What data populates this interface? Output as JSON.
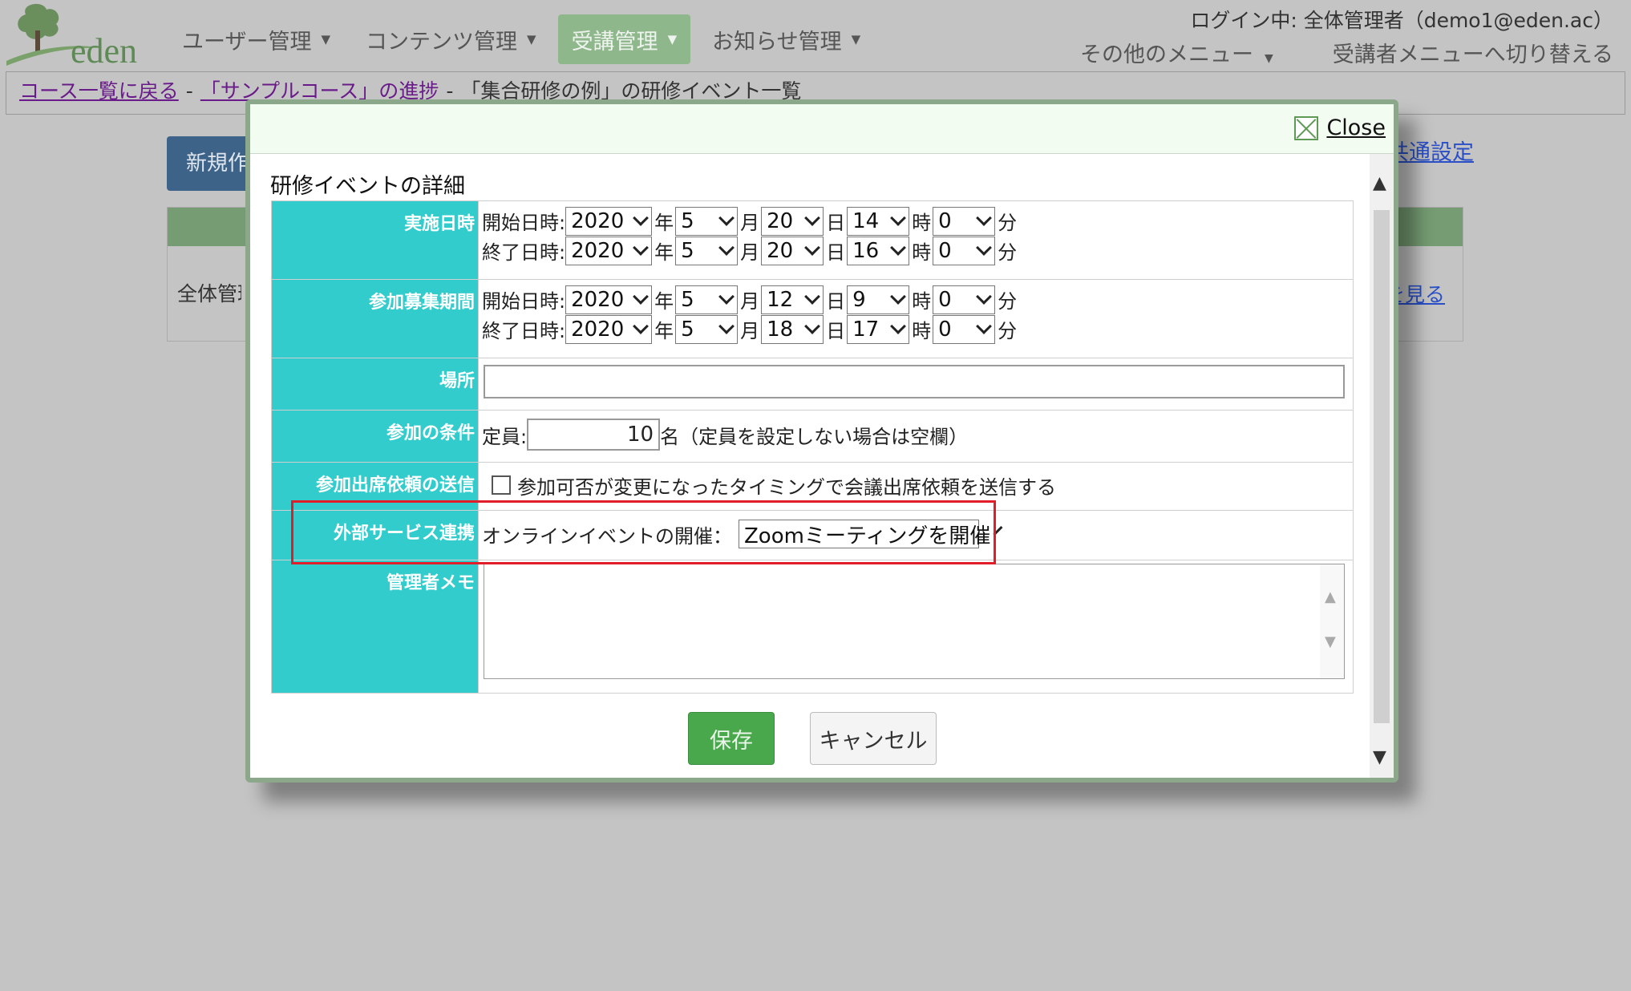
{
  "brand": {
    "name": "eden"
  },
  "nav": [
    {
      "label": "ユーザー管理",
      "active": false
    },
    {
      "label": "コンテンツ管理",
      "active": false
    },
    {
      "label": "受講管理",
      "active": true
    },
    {
      "label": "お知らせ管理",
      "active": false
    }
  ],
  "user": {
    "login_text": "ログイン中: 全体管理者（demo1@eden.ac）"
  },
  "top_menu": {
    "other_label": "その他のメニュー",
    "switch_label": "受講者メニューへ切り替える"
  },
  "breadcrumb": {
    "course_list": "コース一覧に戻る",
    "progress": "「サンプルコース」の進捗",
    "current": "「集合研修の例」の研修イベント一覧",
    "separator": "-"
  },
  "background": {
    "new_button": "新規作成",
    "common_settings": "共通設定",
    "panel_cell": "全体管理者",
    "view_link": "を見る"
  },
  "modal": {
    "close_label": "Close",
    "title": "研修イベントの詳細",
    "units": {
      "year": "年",
      "month": "月",
      "day": "日",
      "hour": "時",
      "minute": "分"
    },
    "start_label": "開始日時:",
    "end_label": "終了日時:",
    "schedule": {
      "label": "実施日時",
      "start": {
        "year": "2020",
        "month": "5",
        "day": "20",
        "hour": "14",
        "minute": "0"
      },
      "end": {
        "year": "2020",
        "month": "5",
        "day": "20",
        "hour": "16",
        "minute": "0"
      }
    },
    "recruit": {
      "label": "参加募集期間",
      "start": {
        "year": "2020",
        "month": "5",
        "day": "12",
        "hour": "9",
        "minute": "0"
      },
      "end": {
        "year": "2020",
        "month": "5",
        "day": "18",
        "hour": "17",
        "minute": "0"
      }
    },
    "place": {
      "label": "場所",
      "value": ""
    },
    "condition": {
      "label": "参加の条件",
      "capacity_label": "定員:",
      "capacity_value": "10",
      "unit_note": "名（定員を設定しない場合は空欄）"
    },
    "attendance": {
      "label": "参加出席依頼の送信",
      "checkbox_label": "参加可否が変更になったタイミングで会議出席依頼を送信する",
      "checked": false
    },
    "external": {
      "label": "外部サービス連携",
      "online_label": "オンラインイベントの開催：",
      "selected": "Zoomミーティングを開催"
    },
    "memo": {
      "label": "管理者メモ",
      "value": ""
    },
    "save_label": "保存",
    "cancel_label": "キャンセル"
  },
  "colors": {
    "label_bg": "#33cccc",
    "save_btn": "#49a84c",
    "highlight": "#e11d2a",
    "nav_active": "#8fb78c",
    "modal_header": "#f2fcf0"
  }
}
